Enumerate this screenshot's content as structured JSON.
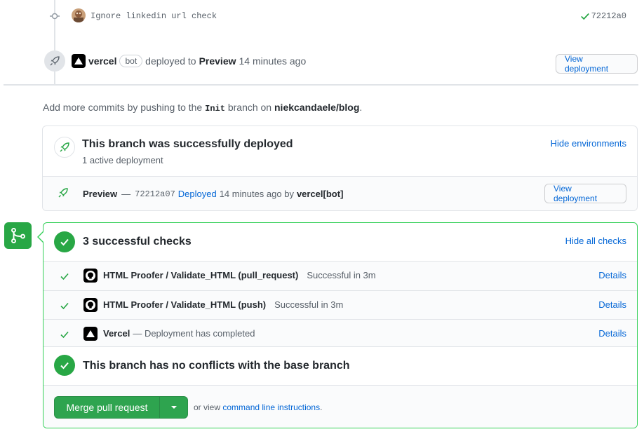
{
  "commit": {
    "message": "Ignore linkedin url check",
    "sha": "72212a0"
  },
  "deploy_event": {
    "actor": "vercel",
    "bot_label": "bot",
    "action": "deployed to",
    "environment": "Preview",
    "time": "14 minutes ago",
    "view_button": "View deployment"
  },
  "add_commits": {
    "prefix": "Add more commits by pushing to the",
    "branch": "Init",
    "middle": "branch on",
    "repo": "niekcandaele/blog",
    "suffix": "."
  },
  "deployment_box": {
    "title": "This branch was successfully deployed",
    "subtitle": "1 active deployment",
    "hide_label": "Hide environments",
    "row": {
      "environment": "Preview",
      "dash": "—",
      "sha": "72212a07",
      "status": "Deployed",
      "time": "14 minutes ago by",
      "actor": "vercel[bot]",
      "view_button": "View deployment"
    }
  },
  "checks": {
    "title": "3 successful checks",
    "hide_label": "Hide all checks",
    "items": [
      {
        "name": "HTML Proofer / Validate_HTML (pull_request)",
        "status": "Successful in 3m",
        "details": "Details",
        "logo": "github-icon"
      },
      {
        "name": "HTML Proofer / Validate_HTML (push)",
        "status": "Successful in 3m",
        "details": "Details",
        "logo": "github-icon"
      },
      {
        "name": "Vercel",
        "status": "— Deployment has completed",
        "details": "Details",
        "logo": "vercel-icon"
      }
    ]
  },
  "conflicts": {
    "title": "This branch has no conflicts with the base branch"
  },
  "merge": {
    "button_label": "Merge pull request",
    "or_view": "or view",
    "cli_link": "command line instructions",
    "cli_suffix": "."
  },
  "colors": {
    "accent": "#0366d6",
    "success": "#28a745",
    "border_success": "#34d058"
  }
}
